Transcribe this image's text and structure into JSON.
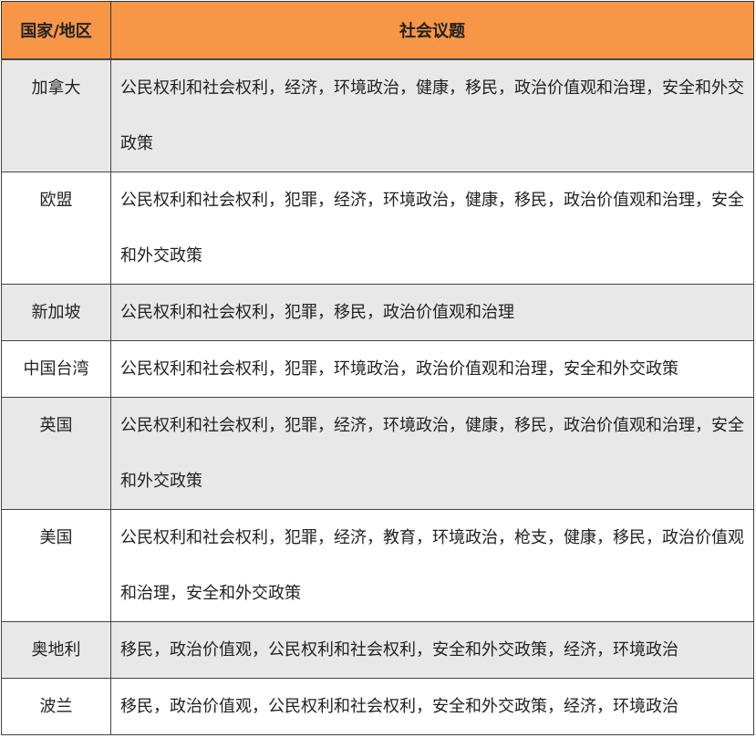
{
  "table": {
    "headers": [
      "国家/地区",
      "社会议题"
    ],
    "rows": [
      {
        "country": "加拿大",
        "issues": "公民权利和社会权利，经济，环境政治，健康，移民，政治价值观和治理，安全和外交政策"
      },
      {
        "country": "欧盟",
        "issues": "公民权利和社会权利，犯罪，经济，环境政治，健康，移民，政治价值观和治理，安全和外交政策"
      },
      {
        "country": "新加坡",
        "issues": "公民权利和社会权利，犯罪，移民，政治价值观和治理"
      },
      {
        "country": "中国台湾",
        "issues": "公民权利和社会权利，犯罪，环境政治，政治价值观和治理，安全和外交政策"
      },
      {
        "country": "英国",
        "issues": "公民权利和社会权利，犯罪，经济，环境政治，健康，移民，政治价值观和治理，安全和外交政策"
      },
      {
        "country": "美国",
        "issues": "公民权利和社会权利，犯罪，经济，教育，环境政治，枪支，健康，移民，政治价值观和治理，安全和外交政策"
      },
      {
        "country": "奥地利",
        "issues": "移民，政治价值观，公民权利和社会权利，安全和外交政策，经济，环境政治"
      },
      {
        "country": "波兰",
        "issues": "移民，政治价值观，公民权利和社会权利，安全和外交政策，经济，环境政治"
      }
    ]
  }
}
